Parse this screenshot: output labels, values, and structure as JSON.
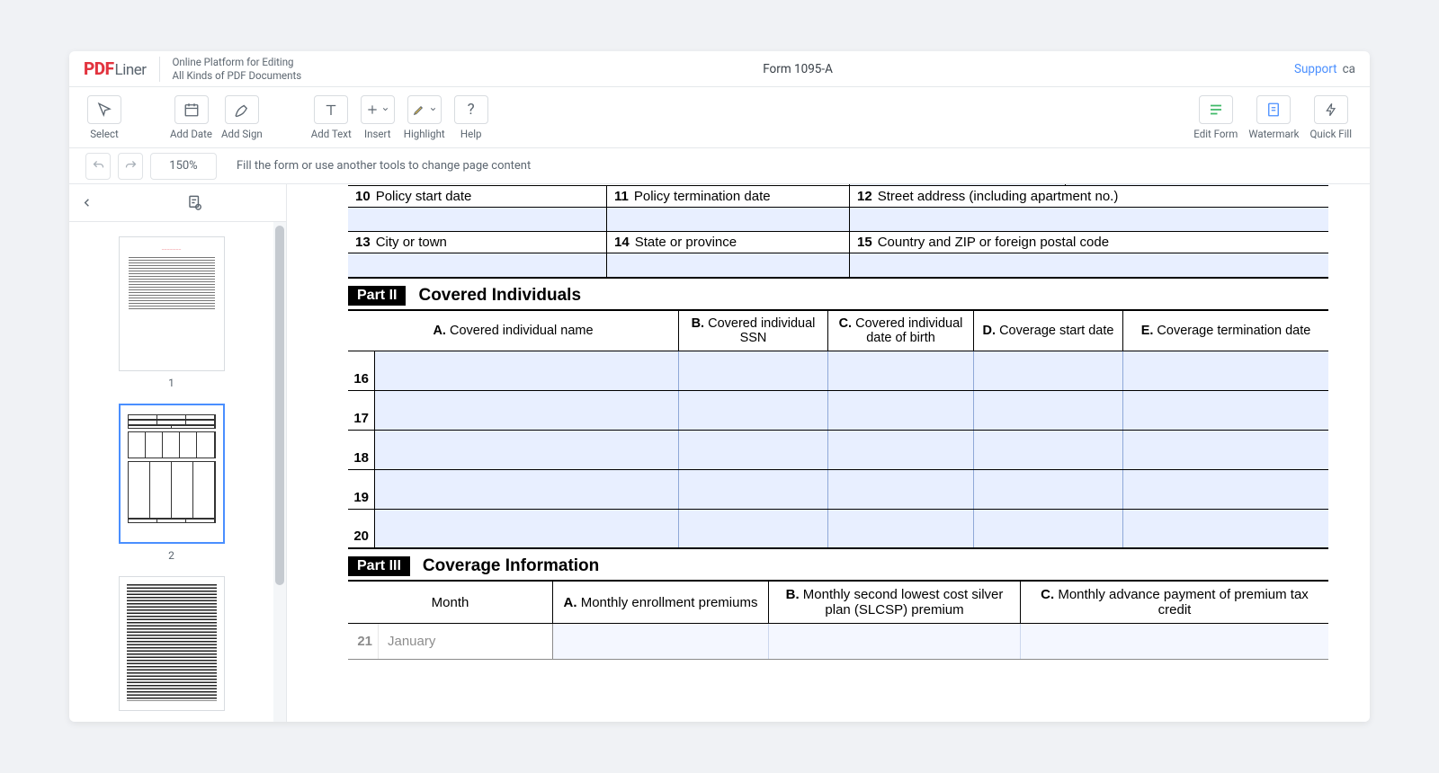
{
  "header": {
    "logo_prefix": "PDF",
    "logo_suffix": "Liner",
    "tagline_line1": "Online Platform for Editing",
    "tagline_line2": "All Kinds of PDF Documents",
    "document_title": "Form 1095-A",
    "support_link": "Support"
  },
  "toolbar": {
    "select": "Select",
    "add_date": "Add Date",
    "add_sign": "Add Sign",
    "add_text": "Add Text",
    "insert": "Insert",
    "highlight": "Highlight",
    "help": "Help",
    "edit_form": "Edit Form",
    "watermark": "Watermark",
    "quick_fill": "Quick Fill"
  },
  "subbar": {
    "zoom": "150%",
    "hint": "Fill the form or use another tools to change page content"
  },
  "thumbnails": {
    "page1": "1",
    "page2": "2",
    "active_index": 2
  },
  "form": {
    "part1_rows": [
      {
        "cells": [
          {
            "num": "10",
            "label": "Policy start date"
          },
          {
            "num": "11",
            "label": "Policy termination date"
          },
          {
            "num": "12",
            "label": "Street address (including apartment no.)"
          }
        ]
      },
      {
        "cells": [
          {
            "num": "13",
            "label": "City or town"
          },
          {
            "num": "14",
            "label": "State or province"
          },
          {
            "num": "15",
            "label": "Country and ZIP or foreign postal code"
          }
        ]
      }
    ],
    "part2": {
      "badge": "Part II",
      "title": "Covered Individuals",
      "columns": [
        {
          "letter": "A.",
          "label": " Covered individual name"
        },
        {
          "letter": "B.",
          "label": " Covered individual SSN"
        },
        {
          "letter": "C.",
          "label": " Covered individual date of birth"
        },
        {
          "letter": "D.",
          "label": " Coverage start date"
        },
        {
          "letter": "E.",
          "label": " Coverage termination date"
        }
      ],
      "row_numbers": [
        "16",
        "17",
        "18",
        "19",
        "20"
      ]
    },
    "part3": {
      "badge": "Part III",
      "title": "Coverage Information",
      "month_header": "Month",
      "columns": [
        {
          "letter": "A.",
          "label": " Monthly enrollment premiums"
        },
        {
          "letter": "B.",
          "label": " Monthly second lowest cost silver plan (SLCSP) premium"
        },
        {
          "letter": "C.",
          "label": " Monthly advance payment of premium tax credit"
        }
      ],
      "first_row_num": "21",
      "first_row_month": "January"
    }
  }
}
